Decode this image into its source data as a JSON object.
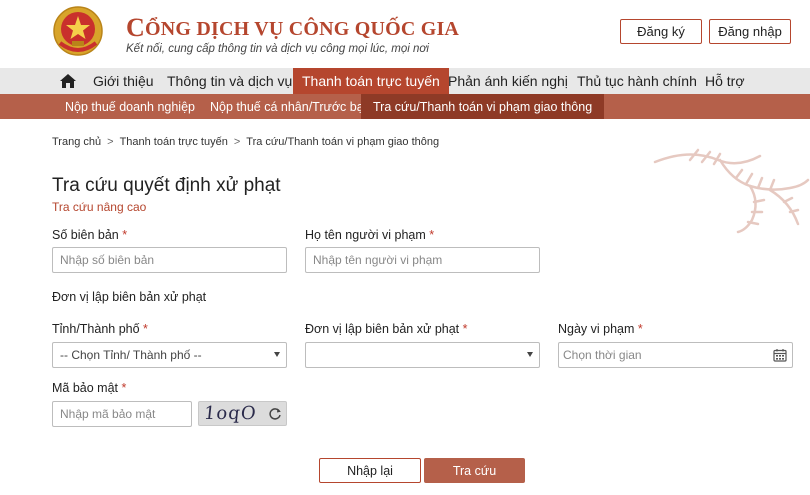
{
  "header": {
    "title_initial": "C",
    "title_rest": "ỔNG DỊCH VỤ CÔNG QUỐC GIA",
    "subtitle": "Kết nối, cung cấp thông tin và dịch vụ công mọi lúc, mọi nơi",
    "register_label": "Đăng ký",
    "login_label": "Đăng nhập"
  },
  "main_nav": {
    "home_icon": "home-icon",
    "items": [
      {
        "label": "Giới thiệu"
      },
      {
        "label": "Thông tin và dịch vụ"
      },
      {
        "label": "Thanh toán trực tuyến",
        "active": true
      },
      {
        "label": "Phản ánh kiến nghị"
      },
      {
        "label": "Thủ tục hành chính"
      },
      {
        "label": "Hỗ trợ"
      }
    ]
  },
  "sub_nav": {
    "items": [
      {
        "label": "Nộp thuế doanh nghiệp"
      },
      {
        "label": "Nộp thuế cá nhân/Trước bạ"
      },
      {
        "label": "Tra cứu/Thanh toán vi phạm giao thông",
        "active": true
      }
    ]
  },
  "breadcrumb": {
    "items": [
      "Trang chủ",
      "Thanh toán trực tuyến",
      "Tra cứu/Thanh toán vi phạm giao thông"
    ],
    "separator": ">"
  },
  "form": {
    "title": "Tra cứu quyết định xử phạt",
    "advanced_link": "Tra cứu nâng cao",
    "required_mark": "*",
    "record_number": {
      "label": "Số biên bản",
      "placeholder": "Nhập số biên bản"
    },
    "violator_name": {
      "label": "Họ tên người vi phạm",
      "placeholder": "Nhập tên người vi phạm"
    },
    "section_label": "Đơn vị lập biên bản xử phạt",
    "province": {
      "label": "Tỉnh/Thành phố",
      "value": "-- Chọn Tỉnh/ Thành phố --"
    },
    "unit": {
      "label": "Đơn vị lập biên bản xử phạt",
      "value": ""
    },
    "date": {
      "label": "Ngày vi phạm",
      "placeholder": "Chọn thời gian"
    },
    "captcha": {
      "label": "Mã bảo mật",
      "placeholder": "Nhập mã bảo mật",
      "code": "1oqO"
    },
    "reset_label": "Nhập lại",
    "search_label": "Tra cứu"
  },
  "colors": {
    "brand": "#b5462e",
    "subnav_bg": "#b5604a",
    "subnav_active": "#8e3a26",
    "nav_bg": "#e8e8e8"
  }
}
